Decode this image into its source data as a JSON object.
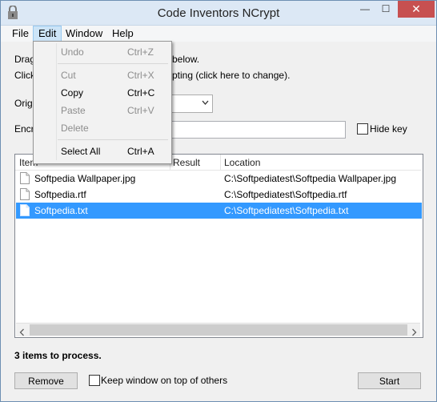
{
  "window": {
    "title": "Code Inventors NCrypt",
    "close_glyph": "✕",
    "min_glyph": "—",
    "max_glyph": "☐"
  },
  "menubar": {
    "file": "File",
    "edit": "Edit",
    "window": "Window",
    "help": "Help"
  },
  "edit_menu": {
    "undo": {
      "label": "Undo",
      "shortcut": "Ctrl+Z"
    },
    "cut": {
      "label": "Cut",
      "shortcut": "Ctrl+X"
    },
    "copy": {
      "label": "Copy",
      "shortcut": "Ctrl+C"
    },
    "paste": {
      "label": "Paste",
      "shortcut": "Ctrl+V"
    },
    "delete": {
      "label": "Delete"
    },
    "select_all": {
      "label": "Select All",
      "shortcut": "Ctrl+A"
    }
  },
  "main": {
    "drag_text_start": "Drag",
    "drag_text_end": "below.",
    "click_text_start": "Click",
    "click_text_end": "pting (click here to change).",
    "orig_label": "Orig",
    "encr_label": "Encr",
    "hide_key_label": "Hide key"
  },
  "list": {
    "headers": {
      "item": "Item",
      "result": "Result",
      "location": "Location"
    },
    "rows": [
      {
        "name": "Softpedia Wallpaper.jpg",
        "location": "C:\\Softpediatest\\Softpedia Wallpaper.jpg"
      },
      {
        "name": "Softpedia.rtf",
        "location": "C:\\Softpediatest\\Softpedia.rtf"
      },
      {
        "name": "Softpedia.txt",
        "location": "C:\\Softpediatest\\Softpedia.txt"
      }
    ]
  },
  "status": {
    "count_text": "3 items to process."
  },
  "footer": {
    "remove": "Remove",
    "keep_on_top": "Keep window on top of others",
    "start": "Start"
  },
  "colors": {
    "selection": "#3399ff",
    "close_button": "#c75050",
    "menu_highlight": "#cce4f7"
  }
}
